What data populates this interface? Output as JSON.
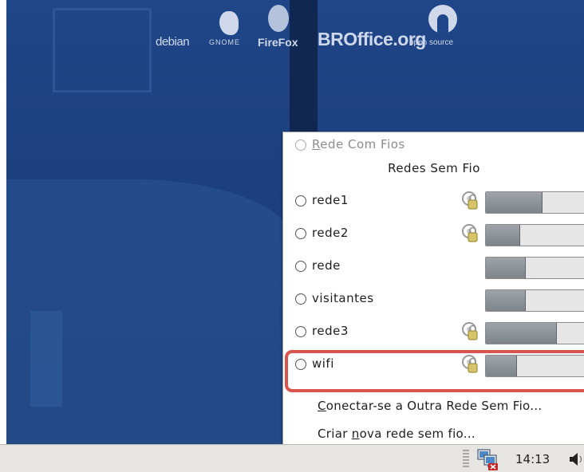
{
  "desktop": {
    "logos": {
      "debian": "debian",
      "gnome": "GNOME",
      "firefox": "FireFox",
      "broffice": "BROffice.org",
      "opensource": "open source"
    }
  },
  "menu": {
    "wired": {
      "label": "Rede Com Fios",
      "mnemonic": "R",
      "enabled": false
    },
    "wireless_header": "Redes Sem Fio",
    "networks": [
      {
        "name": "rede1",
        "secured": true,
        "signal": 0.55
      },
      {
        "name": "rede2",
        "secured": true,
        "signal": 0.33
      },
      {
        "name": "rede",
        "secured": false,
        "signal": 0.38
      },
      {
        "name": "visitantes",
        "secured": false,
        "signal": 0.38
      },
      {
        "name": "rede3",
        "secured": true,
        "signal": 0.69
      },
      {
        "name": "wifi",
        "secured": true,
        "signal": 0.3,
        "highlighted": true
      }
    ],
    "connect_other": "Conectar-se a Outra Rede Sem Fio...",
    "create_new": "Criar nova rede sem fio..."
  },
  "taskbar": {
    "clock": "14:13"
  },
  "colors": {
    "highlight_border": "#d9534f",
    "wallpaper": "#1f4688"
  }
}
